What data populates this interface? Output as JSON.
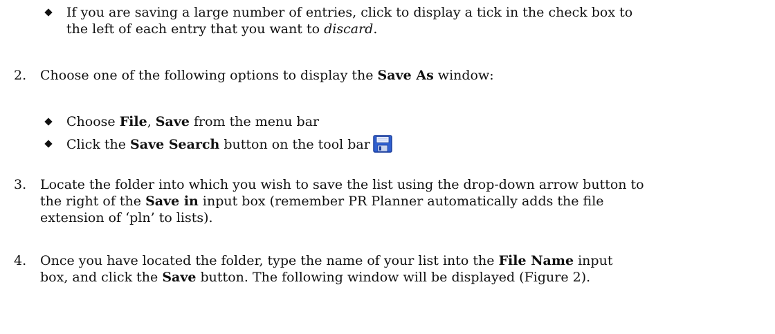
{
  "bullet_discard": {
    "line1": "If you are saving a large number of entries, click to display a tick in the check box to",
    "line2_prefix": "the left of each entry that you want to ",
    "line2_italic": "discard",
    "line2_suffix": "."
  },
  "step2": {
    "number": "2.",
    "prefix": "Choose one of the following options to display the ",
    "bold": "Save As",
    "suffix": " window:"
  },
  "bullet_file_save": {
    "prefix": "Choose ",
    "bold1": "File",
    "sep": ", ",
    "bold2": "Save",
    "suffix": " from the menu bar"
  },
  "bullet_save_search": {
    "prefix": "Click the ",
    "bold": "Save Search",
    "suffix": " button on the tool bar",
    "icon": "floppy-disk-icon"
  },
  "step3": {
    "number": "3.",
    "line1_prefix": "Locate the folder into which you wish to save the list using the drop-down arrow button to",
    "line2_prefix": "the right of the ",
    "line2_bold": "Save in",
    "line2_suffix": " input box (remember PR Planner automatically adds the file",
    "line3": "extension of ‘pln’ to lists)."
  },
  "step4": {
    "number": "4.",
    "line1_prefix": "Once you have located the folder, type the name of your list into the ",
    "line1_bold": "File Name",
    "line1_suffix": " input",
    "line2_prefix": "box, and click the ",
    "line2_bold": "Save",
    "line2_suffix": " button.  The following window will be displayed (Figure 2)."
  },
  "colors": {
    "text": "#111111",
    "icon_blue": "#2f5fd0",
    "icon_dark": "#1c3f9c",
    "icon_label": "#e8eefc"
  }
}
